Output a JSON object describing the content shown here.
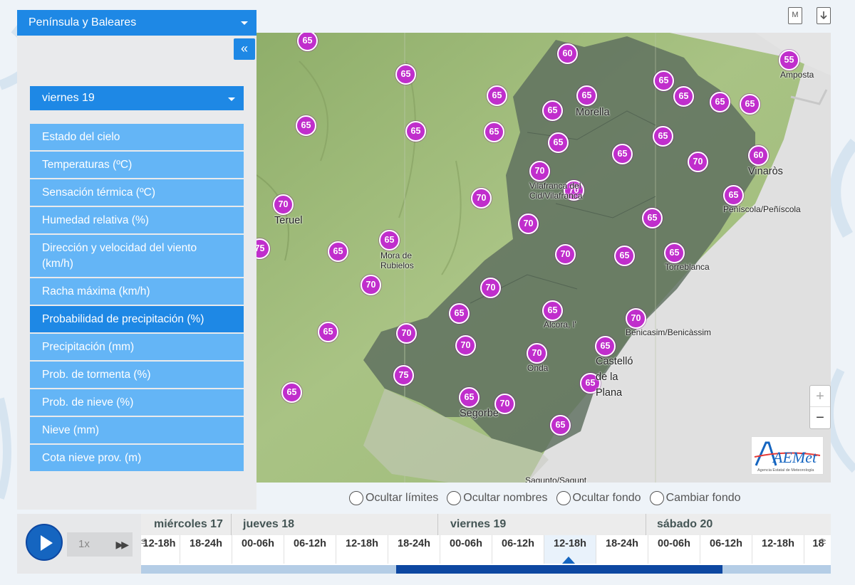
{
  "sidebar": {
    "region": "Península y Baleares",
    "collapse_label": "«",
    "day": "viernes 19",
    "variables": [
      {
        "label": "Estado del cielo"
      },
      {
        "label": "Temperaturas (ºC)"
      },
      {
        "label": "Sensación térmica (ºC)"
      },
      {
        "label": "Humedad relativa (%)"
      },
      {
        "label": "Dirección y velocidad del viento (km/h)"
      },
      {
        "label": "Racha máxima (km/h)"
      },
      {
        "label": "Probabilidad de precipitación (%)",
        "active": true
      },
      {
        "label": "Precipitación (mm)"
      },
      {
        "label": "Prob. de tormenta (%)"
      },
      {
        "label": "Prob. de nieve (%)"
      },
      {
        "label": "Nieve (mm)"
      },
      {
        "label": "Cota nieve prov. (m)"
      }
    ]
  },
  "toolbar": {
    "m_label": "M",
    "download_icon": "download-icon"
  },
  "map": {
    "markers": [
      {
        "value": "65"
      },
      {
        "value": "65"
      },
      {
        "value": "60"
      },
      {
        "value": "55"
      },
      {
        "value": "65"
      },
      {
        "value": "65"
      },
      {
        "value": "65"
      },
      {
        "value": "65"
      },
      {
        "value": "65"
      },
      {
        "value": "65"
      },
      {
        "value": "65"
      },
      {
        "value": "65"
      },
      {
        "value": "65"
      },
      {
        "value": "65"
      },
      {
        "value": "65"
      },
      {
        "value": "65"
      },
      {
        "value": "65"
      },
      {
        "value": "60"
      },
      {
        "value": "70"
      },
      {
        "value": "70"
      },
      {
        "value": "70"
      },
      {
        "value": "65"
      },
      {
        "value": "70"
      },
      {
        "value": "70"
      },
      {
        "value": "65"
      },
      {
        "value": "75"
      },
      {
        "value": "65"
      },
      {
        "value": "65"
      },
      {
        "value": "70"
      },
      {
        "value": "65"
      },
      {
        "value": "65"
      },
      {
        "value": "70"
      },
      {
        "value": "70"
      },
      {
        "value": "70"
      },
      {
        "value": "65"
      },
      {
        "value": "65"
      },
      {
        "value": "70"
      },
      {
        "value": "65"
      },
      {
        "value": "70"
      },
      {
        "value": "70"
      },
      {
        "value": "75"
      },
      {
        "value": "70"
      },
      {
        "value": "65"
      },
      {
        "value": "65"
      },
      {
        "value": "65"
      },
      {
        "value": "65"
      },
      {
        "value": "70"
      },
      {
        "value": "65"
      }
    ],
    "places": [
      {
        "name": "Amposta"
      },
      {
        "name": "Morella"
      },
      {
        "name": "Vinaròs"
      },
      {
        "name": "Vilafranca del Cid/Vilafranca"
      },
      {
        "name": "Peñíscola/Peñíscola"
      },
      {
        "name": "Teruel"
      },
      {
        "name": "Mora de Rubielos"
      },
      {
        "name": "Torreblanca"
      },
      {
        "name": "Alcora, l'"
      },
      {
        "name": "Benicasim/Benicàssim"
      },
      {
        "name": "Onda"
      },
      {
        "name": "Castelló de la Plana"
      },
      {
        "name": "Segorbe"
      },
      {
        "name": "Sagunto/Sagunt"
      }
    ],
    "zoom_in": "+",
    "zoom_out": "−",
    "logo_text": "AEMet",
    "logo_sub": "Agencia Estatal de Meteorología"
  },
  "options": [
    {
      "label": "Ocultar límites"
    },
    {
      "label": "Ocultar nombres"
    },
    {
      "label": "Ocultar fondo"
    },
    {
      "label": "Cambiar fondo"
    }
  ],
  "timeline": {
    "speed": "1x",
    "days": [
      {
        "label": "miércoles 17"
      },
      {
        "label": "jueves 18"
      },
      {
        "label": "viernes 19"
      },
      {
        "label": "sábado 20"
      }
    ],
    "slots": [
      {
        "label": "12-18h"
      },
      {
        "label": "18-24h"
      },
      {
        "label": "00-06h"
      },
      {
        "label": "06-12h"
      },
      {
        "label": "12-18h"
      },
      {
        "label": "18-24h"
      },
      {
        "label": "00-06h"
      },
      {
        "label": "06-12h"
      },
      {
        "label": "12-18h",
        "active": true
      },
      {
        "label": "18-24h"
      },
      {
        "label": "00-06h"
      },
      {
        "label": "06-12h"
      },
      {
        "label": "12-18h"
      },
      {
        "label": "18"
      }
    ]
  },
  "colors": {
    "accent": "#1e88e5",
    "menu_item": "#64b5f6",
    "marker": "#c02ecc",
    "province_shade": "#5d6e5e"
  }
}
